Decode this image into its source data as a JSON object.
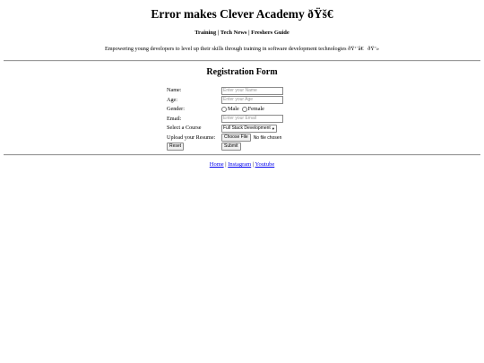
{
  "header": {
    "title": "Error makes Clever Academy ðŸš€",
    "nav": [
      {
        "label": "Training"
      },
      {
        "label": "Tech News"
      },
      {
        "label": "Freshers Guide"
      }
    ],
    "nav_separator": " | ",
    "tagline": "Empowering young developers to level up their skills through training in software development technologies ðŸ‘¨â€   ðŸ’»"
  },
  "form": {
    "title": "Registration Form",
    "fields": {
      "name": {
        "label": "Name:",
        "placeholder": "Enter your Name",
        "value": ""
      },
      "age": {
        "label": "Age:",
        "placeholder": "Enter your Age",
        "value": ""
      },
      "gender": {
        "label": "Gender:",
        "options": [
          "Male",
          "Female"
        ],
        "selected": null
      },
      "email": {
        "label": "Email:",
        "placeholder": "Enter your Email",
        "value": ""
      },
      "course": {
        "label": "Select a Course",
        "selected": "Full Stack Development"
      },
      "resume": {
        "label": "Upload your Resume:",
        "button_label": "Choose File",
        "status": "No file chosen"
      }
    },
    "reset_label": "Reset",
    "submit_label": "Submit"
  },
  "footer": {
    "links": [
      {
        "label": "Home"
      },
      {
        "label": "Instagram"
      },
      {
        "label": "Youtube"
      }
    ],
    "separator": " | "
  }
}
